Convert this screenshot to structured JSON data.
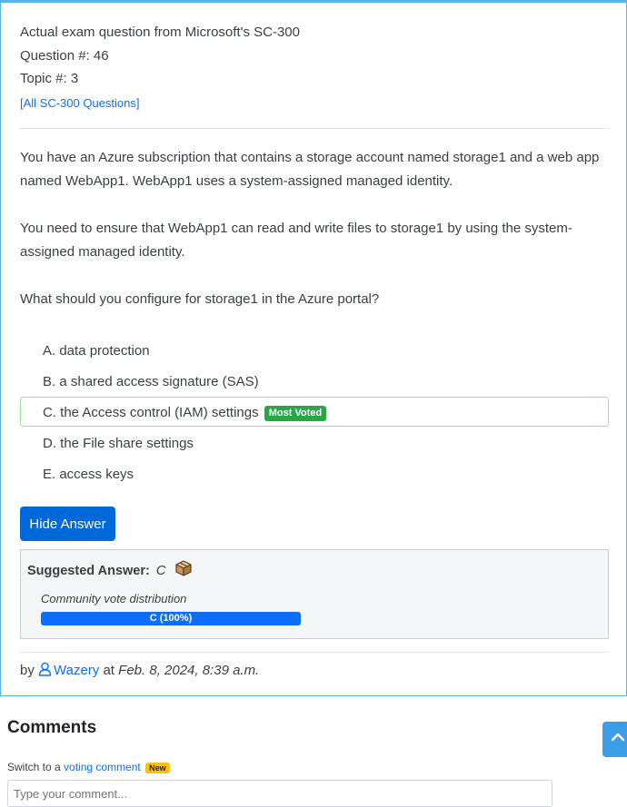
{
  "header": {
    "source_line": "Actual exam question from Microsoft's SC-300",
    "question_number": "Question #: 46",
    "topic": "Topic #: 3",
    "all_questions_link": "[All SC-300 Questions]"
  },
  "question": {
    "paragraphs": [
      "You have an Azure subscription that contains a storage account named storage1 and a web app named WebApp1. WebApp1 uses a system-assigned managed identity.",
      "You need to ensure that WebApp1 can read and write files to storage1 by using the system-assigned managed identity.",
      "What should you configure for storage1 in the Azure portal?"
    ]
  },
  "choices": [
    {
      "text": "A. data protection",
      "correct": false
    },
    {
      "text": "B. a shared access signature (SAS)",
      "correct": false
    },
    {
      "text": "C. the Access control (IAM) settings",
      "correct": true,
      "badge": "Most Voted"
    },
    {
      "text": "D. the File share settings",
      "correct": false
    },
    {
      "text": "E. access keys",
      "correct": false
    }
  ],
  "buttons": {
    "hide_answer": "Hide Answer"
  },
  "answer": {
    "label": "Suggested Answer:",
    "value": "C",
    "box_icon": "package-icon",
    "distribution_label": "Community vote distribution",
    "distribution": [
      {
        "text": "C (100%)",
        "fraction": 1.0
      }
    ],
    "bar_color": "#0d6efd"
  },
  "byline": {
    "prefix": "by",
    "user_icon": "user-icon",
    "username": "Wazery",
    "at": "at",
    "date": "Feb. 8, 2024, 8:39 a.m."
  },
  "comments": {
    "title": "Comments",
    "switch_prefix": "Switch to a",
    "switch_link": "voting comment",
    "new_badge": "New",
    "input_placeholder": "Type your comment..."
  },
  "colors": {
    "link": "#0d6efd",
    "button": "#0069d9",
    "card_border": "#56b6e9",
    "most_voted": "#28a745",
    "correct_border": "#9be59b",
    "new_badge": "#ffc107"
  },
  "scroll_top_icon": "chevron-up-icon"
}
